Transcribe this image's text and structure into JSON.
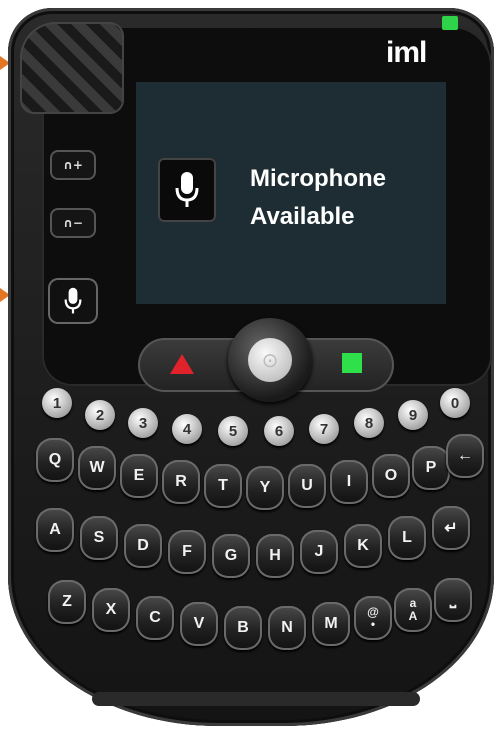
{
  "device": {
    "brand": "iml",
    "led_color": "#2fd34a",
    "arrow_color": "#e27623"
  },
  "screen": {
    "icon": "microphone-icon",
    "line1": "Microphone",
    "line2": "Available"
  },
  "side_buttons": [
    {
      "name": "volume-up-button",
      "label": "∩+"
    },
    {
      "name": "volume-down-button",
      "label": "∩−"
    },
    {
      "name": "microphone-button",
      "icon": "microphone-icon"
    }
  ],
  "nav": {
    "left": "red-triangle-icon",
    "center": "joystick",
    "right": "green-square-icon",
    "left_color": "#e0232a",
    "right_color": "#2ee04a"
  },
  "keyboard": {
    "numbers": [
      "1",
      "2",
      "3",
      "4",
      "5",
      "6",
      "7",
      "8",
      "9",
      "0"
    ],
    "row1": [
      "Q",
      "W",
      "E",
      "R",
      "T",
      "Y",
      "U",
      "I",
      "O",
      "P",
      "←"
    ],
    "row2": [
      "A",
      "S",
      "D",
      "F",
      "G",
      "H",
      "J",
      "K",
      "L",
      "↵"
    ],
    "row3": [
      "Z",
      "X",
      "C",
      "V",
      "B",
      "N",
      "M",
      "@",
      "a",
      "⎵"
    ],
    "row3_sub": {
      "at": "@",
      "dot": "•",
      "shift_lower": "a",
      "shift_upper": "A"
    }
  }
}
